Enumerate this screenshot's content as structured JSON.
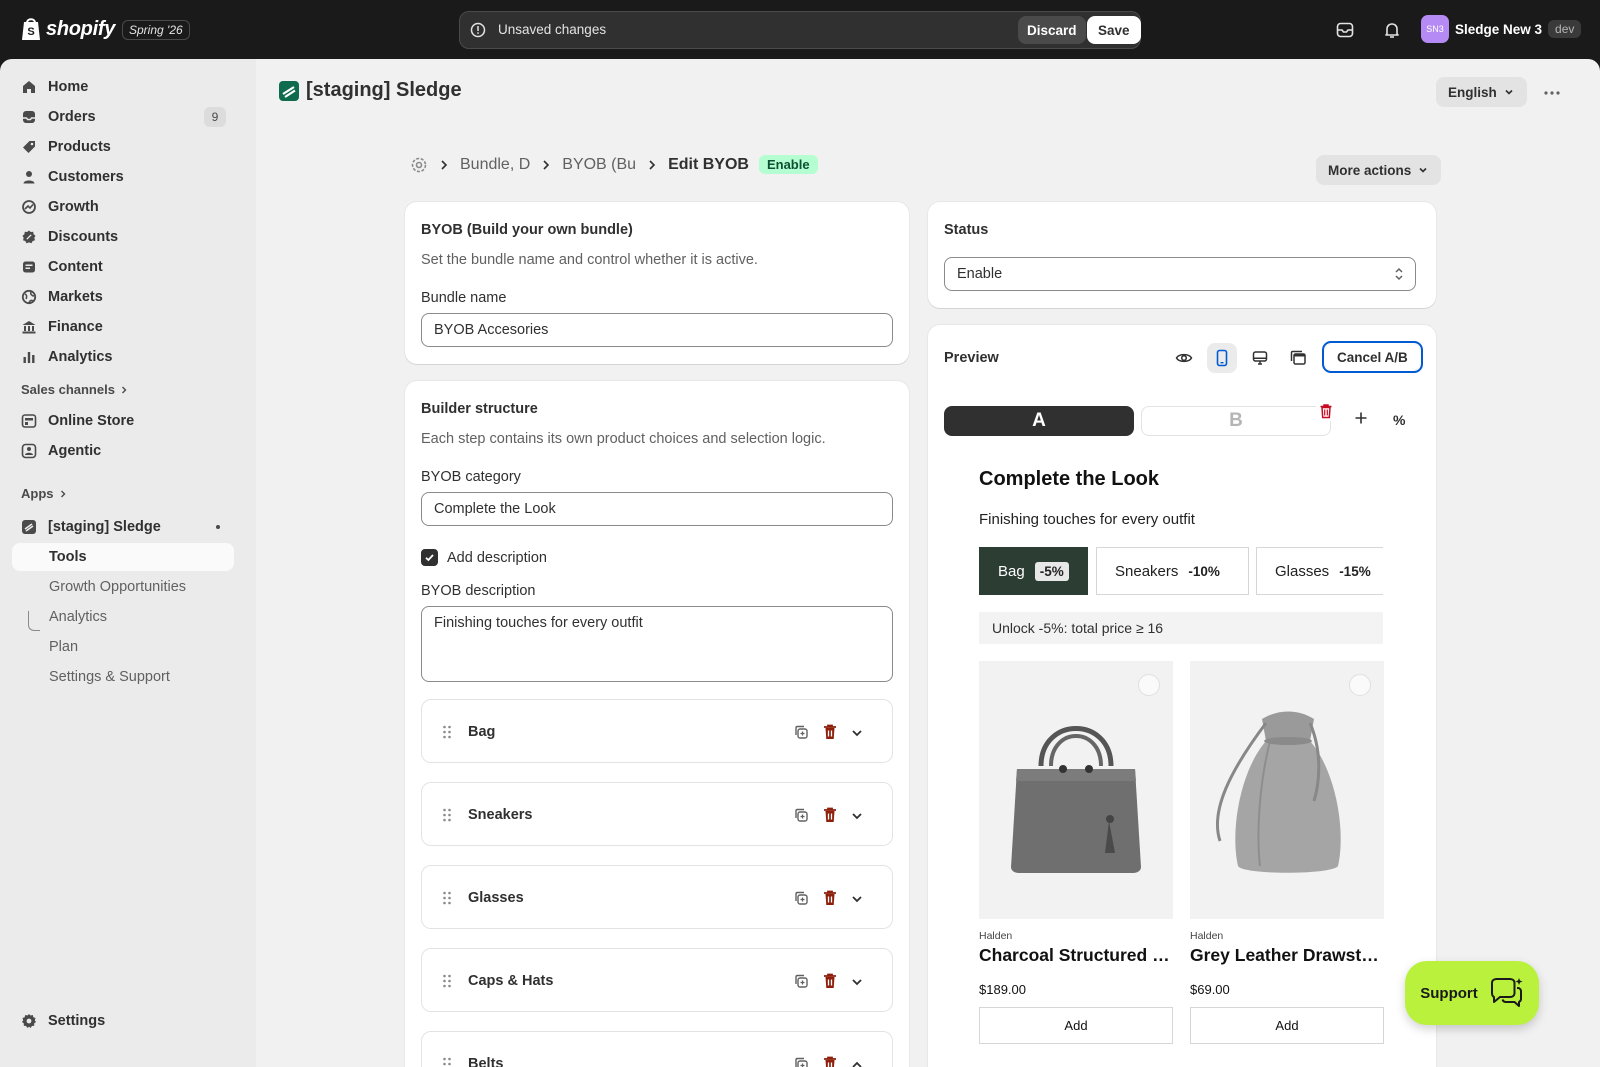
{
  "topbar": {
    "brand": "shopify",
    "edition": "Spring '26",
    "unsaved_message": "Unsaved changes",
    "discard_label": "Discard",
    "save_label": "Save",
    "store_initials": "SN3",
    "store_name": "Sledge New 3",
    "env_badge": "dev"
  },
  "sidebar": {
    "items": [
      {
        "label": "Home",
        "icon": "home-icon"
      },
      {
        "label": "Orders",
        "icon": "orders-icon",
        "badge": "9"
      },
      {
        "label": "Products",
        "icon": "tag-icon"
      },
      {
        "label": "Customers",
        "icon": "person-icon"
      },
      {
        "label": "Growth",
        "icon": "growth-icon"
      },
      {
        "label": "Discounts",
        "icon": "discount-icon"
      },
      {
        "label": "Content",
        "icon": "content-icon"
      },
      {
        "label": "Markets",
        "icon": "globe-icon"
      },
      {
        "label": "Finance",
        "icon": "bank-icon"
      },
      {
        "label": "Analytics",
        "icon": "bar-chart-icon"
      }
    ],
    "sales_channels_label": "Sales channels",
    "channels": [
      {
        "label": "Online Store",
        "icon": "store-icon"
      },
      {
        "label": "Agentic",
        "icon": "agentic-icon"
      }
    ],
    "apps_label": "Apps",
    "app": {
      "label": "[staging] Sledge",
      "icon": "sledge-app-icon"
    },
    "app_subitems": [
      "Tools",
      "Growth Opportunities",
      "Analytics",
      "Plan",
      "Settings & Support"
    ],
    "settings_label": "Settings"
  },
  "page": {
    "app_title": "[staging] Sledge",
    "language": "English",
    "breadcrumbs": [
      "Bundle, D",
      "BYOB (Bu"
    ],
    "current_crumb": "Edit BYOB",
    "status_badge": "Enable",
    "more_actions": "More actions"
  },
  "byob_card": {
    "title": "BYOB (Build your own bundle)",
    "help": "Set the bundle name and control whether it is active.",
    "bundle_name_label": "Bundle name",
    "bundle_name_value": "BYOB Accesories"
  },
  "builder_card": {
    "title": "Builder structure",
    "help": "Each step contains its own product choices and selection logic.",
    "category_label": "BYOB category",
    "category_value": "Complete the Look",
    "add_description_label": "Add description",
    "add_description_checked": true,
    "description_label": "BYOB description",
    "description_value": "Finishing touches for every outfit",
    "steps": [
      "Bag",
      "Sneakers",
      "Glasses",
      "Caps & Hats",
      "Belts"
    ]
  },
  "status_card": {
    "title": "Status",
    "value": "Enable"
  },
  "preview_card": {
    "title": "Preview",
    "cancel_ab_label": "Cancel A/B",
    "variant_a": "A",
    "variant_b": "B",
    "percent_symbol": "%",
    "widget_title": "Complete the Look",
    "widget_subtitle": "Finishing touches for every outfit",
    "tabs": [
      {
        "label": "Bag",
        "discount": "-5%",
        "selected": true
      },
      {
        "label": "Sneakers",
        "discount": "-10%",
        "selected": false
      },
      {
        "label": "Glasses",
        "discount": "-15%",
        "selected": false
      }
    ],
    "unlock_text": "Unlock -5%: total price ≥ 16",
    "products": [
      {
        "vendor": "Halden",
        "title": "Charcoal Structured Tote",
        "price": "$189.00",
        "add_label": "Add",
        "image": "tote-bag-image"
      },
      {
        "vendor": "Halden",
        "title": "Grey Leather Drawstring Bag",
        "price": "$69.00",
        "add_label": "Add",
        "image": "drawstring-bag-image"
      }
    ]
  },
  "support_label": "Support",
  "colors": {
    "topbar": "#1a1a1a",
    "accent_green": "#b9f13c",
    "badge_green": "#b4fed2",
    "selected_tab": "#2c3d34",
    "delete_red": "#8e1f0b",
    "focus_blue": "#005bd3"
  }
}
